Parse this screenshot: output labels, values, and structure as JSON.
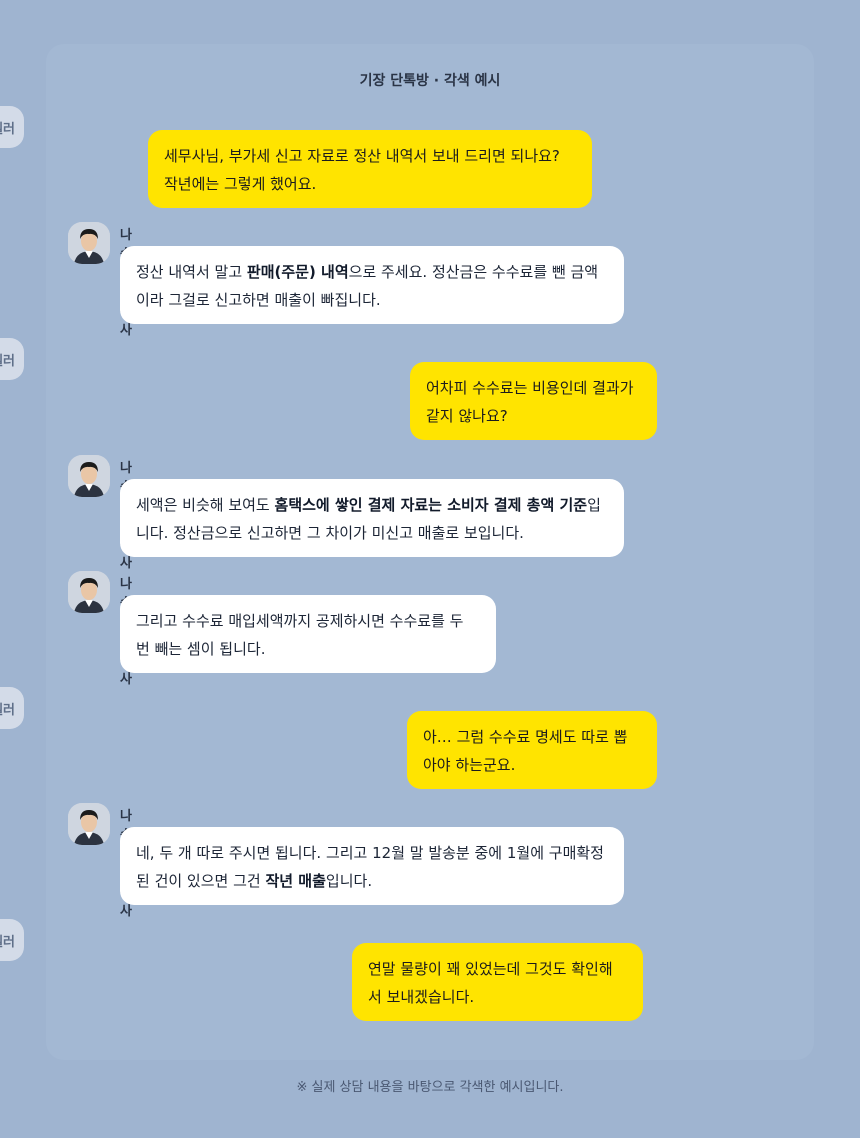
{
  "title": "기장 단톡방 · 각색 예시",
  "seller": {
    "name": "셀러",
    "avatar_label": "셀러"
  },
  "advisor": {
    "name": "나승리 세무사"
  },
  "messages": [
    {
      "from": "seller",
      "lines": [
        "세무사님, 부가세 신고 자료로 정산 내역서 보내 드리면 되나요?",
        "작년에는 그렇게 했어요."
      ]
    },
    {
      "from": "advisor",
      "parts": [
        [
          "정산 내역서 말고 ",
          false
        ],
        [
          "판매(주문) 내역",
          true
        ],
        [
          "으로 주세요. 정산금은 수수료를 뺀 금액",
          false
        ]
      ],
      "line2": "이라 그걸로 신고하면 매출이 빠집니다."
    },
    {
      "from": "seller",
      "lines": [
        "어차피 수수료는 비용인데 결과가",
        "같지 않나요?"
      ]
    },
    {
      "from": "advisor",
      "parts": [
        [
          "세액은 비슷해 보여도 ",
          false
        ],
        [
          "홈택스에 쌓인 결제 자료는 소비자 결제 총액 기준",
          true
        ],
        [
          "입",
          false
        ]
      ],
      "line2": "니다. 정산금으로 신고하면 그 차이가 미신고 매출로 보입니다."
    },
    {
      "from": "advisor",
      "lines": [
        "그리고 수수료 매입세액까지 공제하시면 수수료를 두",
        "번 빼는 셈이 됩니다."
      ]
    },
    {
      "from": "seller",
      "lines": [
        "아… 그럼 수수료 명세도 따로 뽑",
        "아야 하는군요."
      ]
    },
    {
      "from": "advisor",
      "line1": "네, 두 개 따로 주시면 됩니다. 그리고 12월 말 발송분 중에 1월에 구매확정",
      "parts2": [
        [
          "된 건이 있으면 그건 ",
          false
        ],
        [
          "작년 매출",
          true
        ],
        [
          "입니다.",
          false
        ]
      ]
    },
    {
      "from": "seller",
      "lines": [
        "연말 물량이 꽤 있었는데 그것도 확인해",
        "서 보내겠습니다."
      ]
    }
  ],
  "footnote": "※ 실제 상담 내용을 바탕으로 각색한 예시입니다.",
  "colors": {
    "background": "#9fb4d0",
    "panel": "#a3b8d3",
    "seller_bubble": "#ffe400",
    "advisor_bubble": "#ffffff"
  }
}
